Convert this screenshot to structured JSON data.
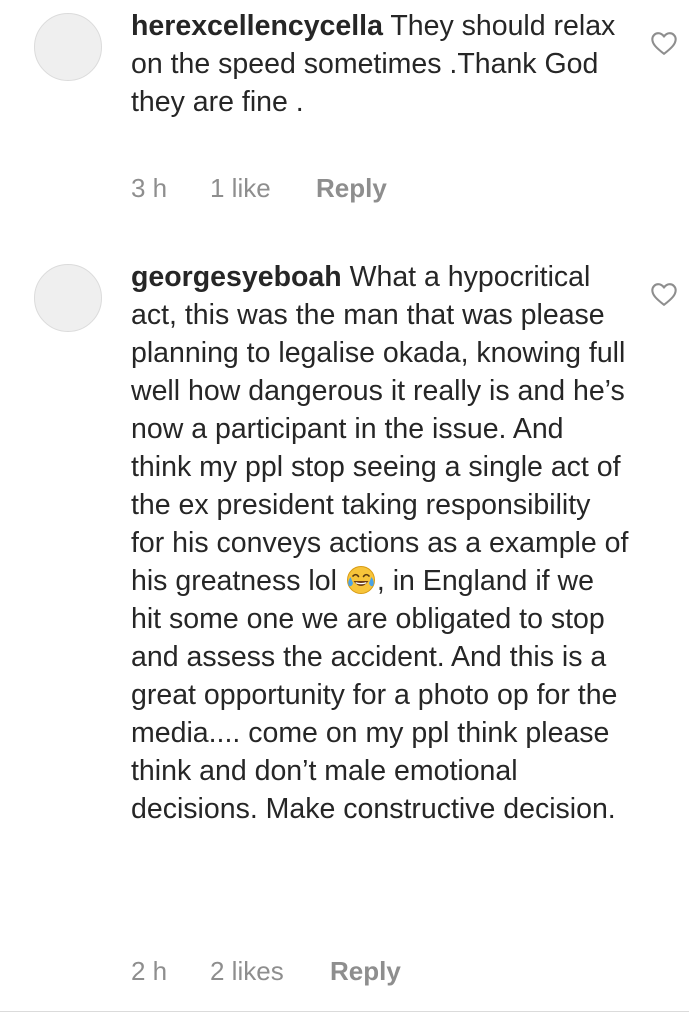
{
  "comments": [
    {
      "username": "herexcellencycella",
      "text": " They should relax on the speed sometimes .Thank God they are fine .",
      "time": "3 h",
      "likes": "1 like",
      "reply": "Reply",
      "like_icon": "heart-outline-icon"
    },
    {
      "username": "georgesyeboah",
      "text_before_emoji": " What a hypocritical act, this was the man that was please planning to legalise okada, knowing full well how dangerous it really is and he’s now a participant in the issue. And think my ppl stop seeing a single act of the ex president taking responsibility for his conveys actions as a example of his greatness lol ",
      "emoji": "face-with-tears-of-joy",
      "text_after_emoji": ", in England if we hit some one we are obligated to stop and assess the accident. And this is a great opportunity for a photo op for the media.... come on my ppl think please think and don’t male emotional decisions. Make constructive decision.",
      "time": "2 h",
      "likes": "2 likes",
      "reply": "Reply",
      "like_icon": "heart-outline-icon"
    }
  ],
  "colors": {
    "text": "#262626",
    "meta": "#8e8e8e",
    "avatar_placeholder": "#efefef",
    "divider": "#dbdbdb"
  }
}
